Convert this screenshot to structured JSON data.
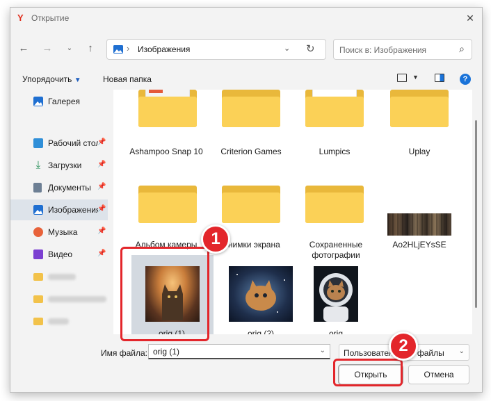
{
  "window": {
    "title": "Открытие",
    "icon": "yandex-browser-icon",
    "close_icon": "close-icon"
  },
  "navbar": {
    "back_icon": "arrow-left-icon",
    "forward_icon": "arrow-right-icon",
    "history_icon": "chevron-down-icon",
    "up_icon": "arrow-up-icon",
    "address": "Изображения",
    "search_placeholder": "Поиск в: Изображения"
  },
  "toolbar": {
    "organize_label": "Упорядочить",
    "new_folder_label": "Новая папка"
  },
  "sidebar": {
    "items": [
      {
        "label": "Галерея",
        "icon": "gallery-icon",
        "pinned": false
      },
      {
        "label": "Рабочий стол",
        "icon": "desktop-icon",
        "pinned": true
      },
      {
        "label": "Загрузки",
        "icon": "download-icon",
        "pinned": true
      },
      {
        "label": "Документы",
        "icon": "documents-icon",
        "pinned": true
      },
      {
        "label": "Изображения",
        "icon": "pictures-icon",
        "pinned": true,
        "selected": true
      },
      {
        "label": "Музыка",
        "icon": "music-icon",
        "pinned": true
      },
      {
        "label": "Видео",
        "icon": "video-icon",
        "pinned": true
      }
    ]
  },
  "files": [
    {
      "name": "Ashampoo Snap 10",
      "type": "folder"
    },
    {
      "name": "Criterion Games",
      "type": "folder"
    },
    {
      "name": "Lumpics",
      "type": "folder"
    },
    {
      "name": "Uplay",
      "type": "folder"
    },
    {
      "name": "Альбом камеры",
      "type": "folder"
    },
    {
      "name": "Снимки экрана",
      "type": "folder"
    },
    {
      "name": "Сохраненные фотографии",
      "type": "folder"
    },
    {
      "name": "Ao2HLjEYsSE",
      "type": "image"
    },
    {
      "name": "orig (1)",
      "type": "image",
      "selected": true
    },
    {
      "name": "orig (2)",
      "type": "image"
    },
    {
      "name": "orig",
      "type": "image"
    }
  ],
  "bottom": {
    "filename_label": "Имя файла:",
    "filename_value": "orig (1)",
    "filetype_value": "Пользовательские файлы",
    "open_label": "Открыть",
    "cancel_label": "Отмена"
  },
  "annotations": {
    "step1": "1",
    "step2": "2",
    "color": "#e3262b"
  },
  "colors": {
    "folder_back": "#e9b83b",
    "folder_front": "#fbd157",
    "accent": "#1a73d9"
  }
}
